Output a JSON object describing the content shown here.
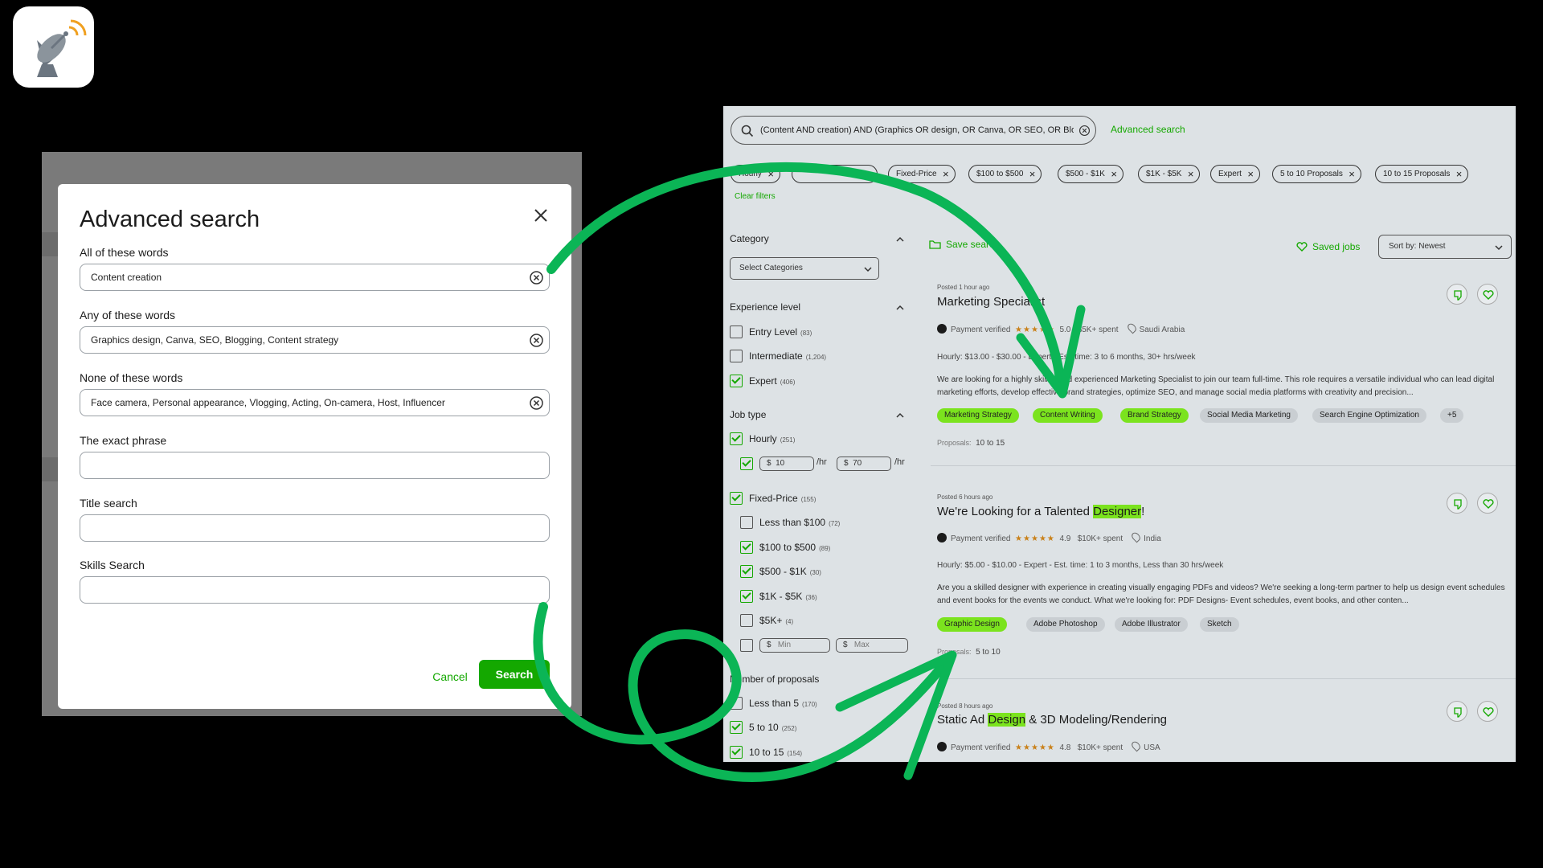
{
  "modal": {
    "title": "Advanced search",
    "fields": [
      {
        "label": "All of these words",
        "value": "Content creation"
      },
      {
        "label": "Any of these words",
        "value": "Graphics design, Canva, SEO, Blogging, Content strategy"
      },
      {
        "label": "None of these words",
        "value": "Face camera, Personal appearance, Vlogging, Acting, On-camera, Host, Influencer"
      },
      {
        "label": "The exact phrase",
        "value": ""
      },
      {
        "label": "Title search",
        "value": ""
      },
      {
        "label": "Skills Search",
        "value": ""
      }
    ],
    "cancel_label": "Cancel",
    "search_label": "Search"
  },
  "results": {
    "query": "(Content AND creation) AND (Graphics OR design, OR Canva, OR SEO, OR Blo...",
    "advanced_link": "Advanced search",
    "chips": [
      "Hourly",
      "Fixed-Price",
      "$100 to $500",
      "$500 - $1K",
      "$1K - $5K",
      "Expert",
      "5 to 10 Proposals",
      "10 to 15 Proposals"
    ],
    "clear_filters": "Clear filters",
    "save_search": "Save search",
    "saved_jobs": "Saved jobs",
    "sort_label": "Sort by: Newest",
    "sidebar": {
      "category_heading": "Category",
      "category_placeholder": "Select Categories",
      "experience_heading": "Experience level",
      "experience": [
        {
          "label": "Entry Level",
          "count": "(83)",
          "checked": false
        },
        {
          "label": "Intermediate",
          "count": "(1,204)",
          "checked": false
        },
        {
          "label": "Expert",
          "count": "(406)",
          "checked": true
        }
      ],
      "jobtype_heading": "Job type",
      "hourly": {
        "label": "Hourly",
        "count": "(251)",
        "min": "10",
        "max": "70",
        "unit": "/hr",
        "currency": "$"
      },
      "fixed": {
        "label": "Fixed-Price",
        "count": "(155)"
      },
      "fixed_options": [
        {
          "label": "Less than $100",
          "count": "(72)",
          "checked": false
        },
        {
          "label": "$100 to $500",
          "count": "(89)",
          "checked": true
        },
        {
          "label": "$500 - $1K",
          "count": "(30)",
          "checked": true
        },
        {
          "label": "$1K - $5K",
          "count": "(36)",
          "checked": true
        },
        {
          "label": "$5K+",
          "count": "(4)",
          "checked": false
        }
      ],
      "min_placeholder": "Min",
      "max_placeholder": "Max",
      "proposals_heading": "Number of proposals",
      "proposals": [
        {
          "label": "Less than 5",
          "count": "(170)",
          "checked": false
        },
        {
          "label": "5 to 10",
          "count": "(252)",
          "checked": true
        },
        {
          "label": "10 to 15",
          "count": "(154)",
          "checked": true
        }
      ]
    },
    "jobs": [
      {
        "posted": "Posted 1 hour ago",
        "title": "Marketing Specialist",
        "verified": "Payment verified",
        "rating": "5.0",
        "spent": "$5K+ spent",
        "location": "Saudi Arabia",
        "terms": "Hourly: $13.00 - $30.00 - Expert - Est. time: 3 to 6 months, 30+ hrs/week",
        "description": "We are looking for a highly skilled and experienced Marketing Specialist to join our team full-time. This role requires a versatile individual who can lead digital marketing efforts, develop effective brand strategies, optimize SEO, and manage social media platforms with creativity and precision...",
        "tags": [
          "Marketing Strategy",
          "Content Writing",
          "Brand Strategy",
          "Social Media Marketing",
          "Search Engine Optimization",
          "+5"
        ],
        "proposals_label": "Proposals:",
        "proposals": "10 to 15"
      },
      {
        "posted": "Posted 6 hours ago",
        "title_pre": "We're Looking for a Talented ",
        "title_hl": "Designer",
        "title_post": "!",
        "verified": "Payment verified",
        "rating": "4.9",
        "spent": "$10K+ spent",
        "location": "India",
        "terms": "Hourly: $5.00 - $10.00 - Expert - Est. time: 1 to 3 months, Less than 30 hrs/week",
        "description": "Are you a skilled designer with experience in creating visually engaging PDFs and videos? We're seeking a long-term partner to help us design event schedules and event books for the events we conduct. What we're looking for: PDF Designs- Event schedules, event books, and other conten...",
        "tags": [
          "Graphic Design",
          "Adobe Photoshop",
          "Adobe Illustrator",
          "Sketch"
        ],
        "proposals_label": "Proposals:",
        "proposals": "5 to 10"
      },
      {
        "posted": "Posted 8 hours ago",
        "title_pre": "Static Ad ",
        "title_hl": "Design",
        "title_post": " & 3D Modeling/Rendering",
        "verified": "Payment verified",
        "rating": "4.8",
        "spent": "$10K+ spent",
        "location": "USA"
      }
    ]
  },
  "colors": {
    "accent": "#14a800",
    "highlight": "#7be31e",
    "arrow": "#0bb556"
  },
  "icons": [
    "satellite-dish-icon",
    "close-icon",
    "clear-circle-icon",
    "search-icon",
    "heart-icon",
    "thumbs-down-icon",
    "folder-icon",
    "chevron-down-icon",
    "chevron-up-icon",
    "location-pin-icon",
    "verified-badge-icon"
  ]
}
